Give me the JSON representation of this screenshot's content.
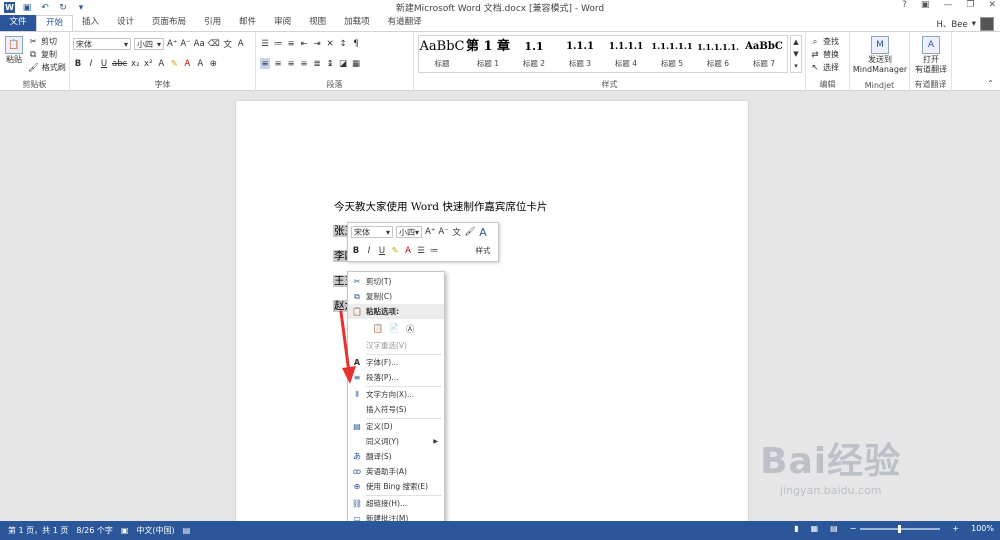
{
  "window": {
    "title": "新建Microsoft Word 文档.docx [兼容模式] - Word",
    "controls": [
      "?",
      "▣",
      "—",
      "❐",
      "✕"
    ],
    "user": "H、Bee"
  },
  "tabs": [
    "文件",
    "开始",
    "插入",
    "设计",
    "页面布局",
    "引用",
    "邮件",
    "审阅",
    "视图",
    "加载项",
    "有道翻译"
  ],
  "ribbon": {
    "clipboard": {
      "paste": "粘贴",
      "cut": "剪切",
      "copy": "复制",
      "format_painter": "格式刷",
      "label": "剪贴板"
    },
    "font": {
      "name": "宋体",
      "size": "小四",
      "label": "字体"
    },
    "paragraph": {
      "label": "段落"
    },
    "styles": {
      "label": "样式",
      "items": [
        {
          "preview": "AaBbC",
          "name": "标题"
        },
        {
          "preview": "第 1 章",
          "name": "标题 1"
        },
        {
          "preview": "1.1",
          "name": "标题 2"
        },
        {
          "preview": "1.1.1",
          "name": "标题 3"
        },
        {
          "preview": "1.1.1.1",
          "name": "标题 4"
        },
        {
          "preview": "1.1.1.1.1",
          "name": "标题 5"
        },
        {
          "preview": "1.1.1.1.1.",
          "name": "标题 6"
        },
        {
          "preview": "AaBbC",
          "name": "标题 7"
        }
      ]
    },
    "editing": {
      "find": "查找",
      "replace": "替换",
      "select": "选择",
      "label": "编辑"
    },
    "mindjet": {
      "send": "发送到",
      "target": "MindManager",
      "label": "Mindjet"
    },
    "youdao": {
      "open": "打开",
      "translate": "有道翻译",
      "label": "有道翻译"
    }
  },
  "document": {
    "line1": "今天教大家使用 Word 快速制作嘉宾席位卡片",
    "names": [
      "张三",
      "李四",
      "王五",
      "赵六"
    ]
  },
  "mini_toolbar": {
    "font": "宋体",
    "size": "小四",
    "styles": "样式"
  },
  "context_menu": {
    "cut": "剪切(T)",
    "copy": "复制(C)",
    "paste_options": "粘贴选项:",
    "hanzi": "汉字重选(V)",
    "font": "字体(F)...",
    "paragraph": "段落(P)...",
    "text_direction": "文字方向(X)...",
    "insert_symbol": "插入符号(S)",
    "define": "定义(D)",
    "synonyms": "同义词(Y)",
    "translate": "翻译(S)",
    "english_assistant": "英语助手(A)",
    "bing": "使用 Bing 搜索(E)",
    "hyperlink": "超链接(H)...",
    "new_comment": "新建批注(M)"
  },
  "status": {
    "page": "第 1 页，共 1 页",
    "words": "8/26 个字",
    "lang": "中文(中国)",
    "zoom": "100%"
  },
  "watermark": {
    "brand": "Bai经验",
    "url": "jingyan.baidu.com"
  },
  "colors": {
    "accent": "#2b579a",
    "arrow": "#e8302f"
  }
}
